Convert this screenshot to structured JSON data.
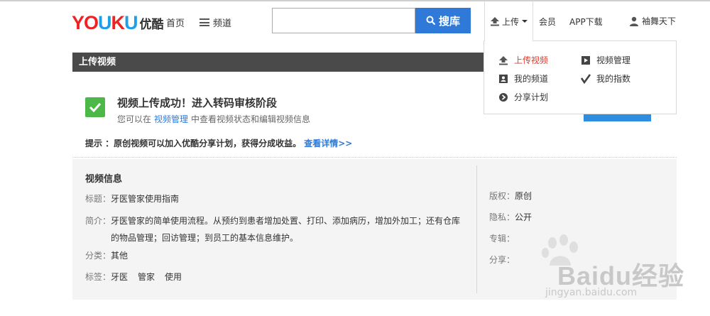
{
  "header": {
    "logo_en_a": "YO",
    "logo_en_u": "U",
    "logo_en_b": "K",
    "logo_en_c": "U",
    "logo_cn": "优酷",
    "nav_home": "首页",
    "nav_channel": "频道",
    "search_placeholder": "",
    "search_button": "搜库",
    "upload_label": "上传",
    "nav_vip": "会员",
    "nav_app": "APP下载",
    "user_name": "袖舞天下"
  },
  "dropdown": {
    "items": [
      {
        "label": "上传视频",
        "icon": "upload-icon"
      },
      {
        "label": "视频管理",
        "icon": "video-manage-icon"
      },
      {
        "label": "我的频道",
        "icon": "channel-icon"
      },
      {
        "label": "我的指数",
        "icon": "index-icon"
      },
      {
        "label": "分享计划",
        "icon": "share-icon"
      }
    ]
  },
  "section": {
    "title": "上传视频"
  },
  "success": {
    "title": "视频上传成功！进入转码审核阶段",
    "sub_prefix": "您可以在",
    "sub_link": "视频管理",
    "sub_suffix": "中查看视频状态和编辑视频信息",
    "tip_text": "提示 ：原创视频可以加入优酷分享计划，获得分成收益。",
    "tip_link": "查看详情>>"
  },
  "info": {
    "heading": "视频信息",
    "title_label": "标题：",
    "title_value": "牙医管家使用指南",
    "desc_label": "简介：",
    "desc_value": "牙医管家的简单使用流程。从预约到患者增加处置、打印、添加病历，增加外加工；还有仓库的物品管理；回访管理；到员工的基本信息维护。",
    "category_label": "分类：",
    "category_value": "其他",
    "tags_label": "标签：",
    "tags": [
      "牙医",
      "管家",
      "使用"
    ],
    "copyright_label": "版权：",
    "copyright_value": "原创",
    "privacy_label": "隐私：",
    "privacy_value": "公开",
    "album_label": "专辑：",
    "share_label": "分享："
  },
  "watermark": {
    "text": "Baidu经验",
    "url": "jingyan.baidu.com"
  },
  "colors": {
    "accent_blue": "#2f7ad8",
    "success_green": "#4cb848",
    "active_red": "#e23a2c",
    "bar_dark": "#4a4a4a"
  }
}
